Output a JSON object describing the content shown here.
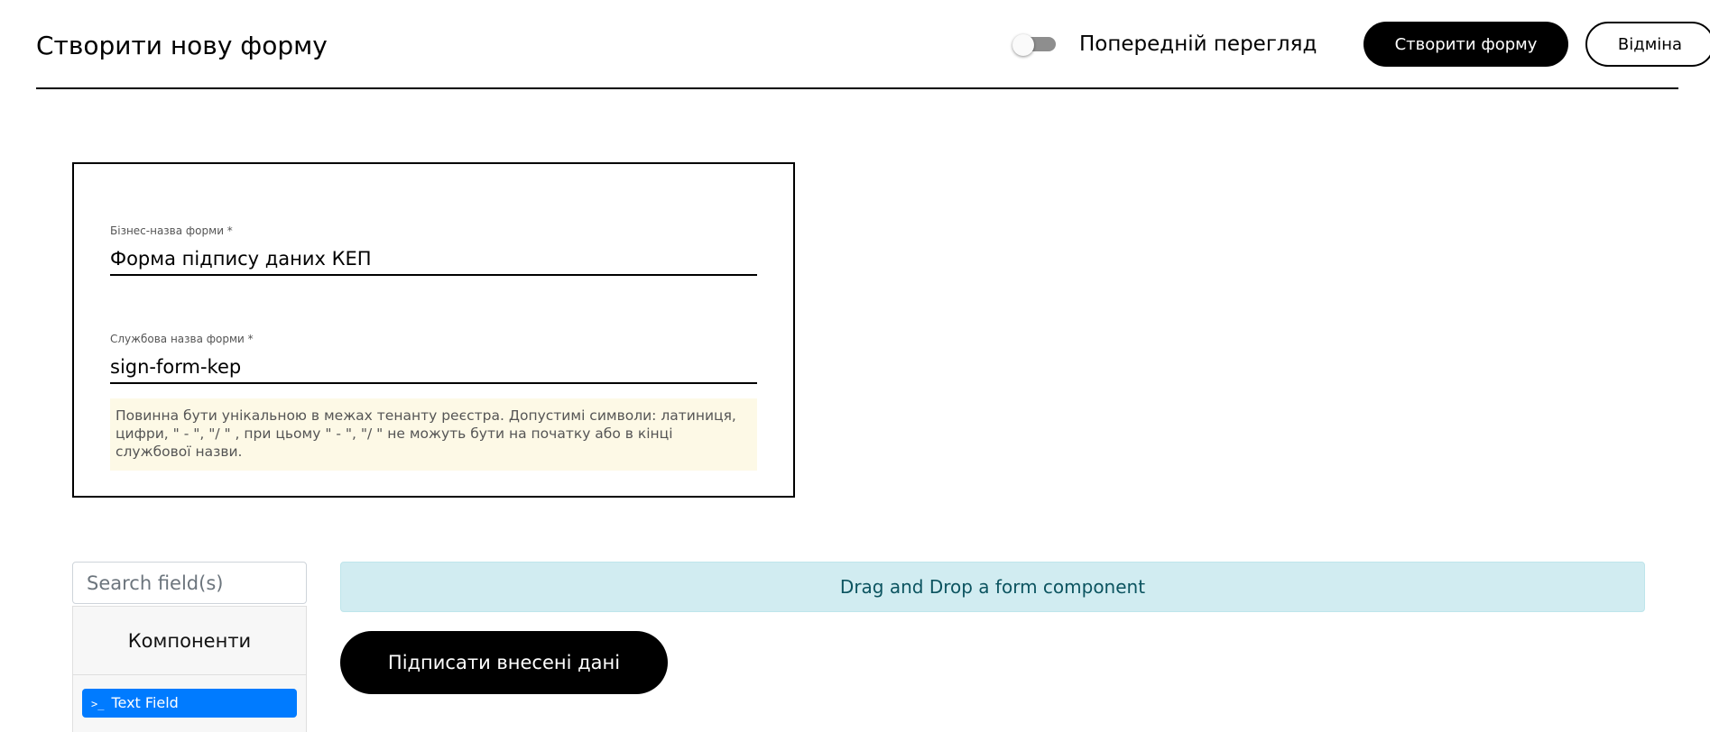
{
  "header": {
    "title": "Створити нову форму",
    "preview_label": "Попередній перегляд",
    "preview_enabled": false,
    "create_label": "Створити форму",
    "cancel_label": "Відміна"
  },
  "form": {
    "business_name": {
      "label": "Бізнес-назва форми *",
      "value": "Форма підпису даних КЕП"
    },
    "service_name": {
      "label": "Службова назва форми *",
      "value": "sign-form-kep",
      "hint": "Повинна бути унікальною в межах тенанту реєстра. Допустимі символи: латиниця, цифри, \" - \", \"/ \" , при цьому  \" - \", \"/ \" не можуть бути на початку або в кінці службової назви."
    }
  },
  "builder": {
    "search_placeholder": "Search field(s)",
    "components_title": "Компоненти",
    "components": [
      {
        "label": "Text Field",
        "icon": "terminal-icon"
      }
    ],
    "dropzone_text": "Drag and Drop a form component",
    "sign_button_label": "Підписати внесені дані"
  },
  "colors": {
    "component_active": "#007bff",
    "dropzone_bg": "#d1ecf1",
    "dropzone_text": "#0c5460",
    "hint_bg": "#fdf9e6",
    "primary_button": "#000000"
  }
}
